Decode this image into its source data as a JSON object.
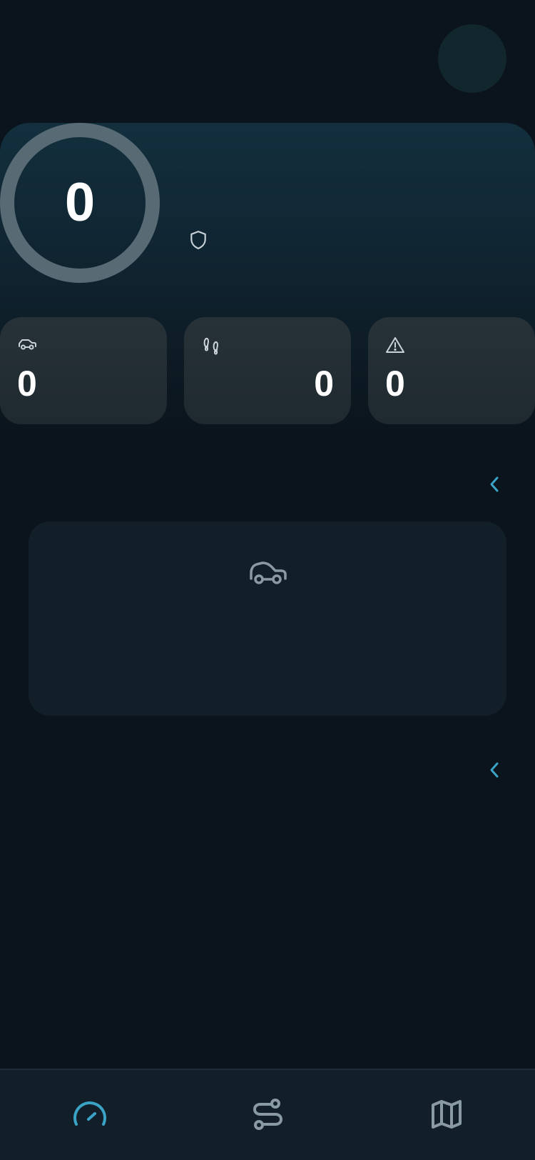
{
  "score": {
    "value": "0"
  },
  "stats": {
    "trips": {
      "value": "0",
      "icon": "car-icon"
    },
    "steps": {
      "value": "0",
      "icon": "footprints-icon"
    },
    "alerts": {
      "value": "0",
      "icon": "warning-icon"
    }
  },
  "nav": {
    "items": [
      {
        "id": "dashboard",
        "icon": "speedometer-icon",
        "active": true
      },
      {
        "id": "routes",
        "icon": "route-icon",
        "active": false
      },
      {
        "id": "map",
        "icon": "map-icon",
        "active": false
      }
    ]
  },
  "colors": {
    "background": "#0b141c",
    "accent": "#3aa3c6",
    "icon_muted": "#8a9aa5",
    "ring": "#586a73"
  }
}
